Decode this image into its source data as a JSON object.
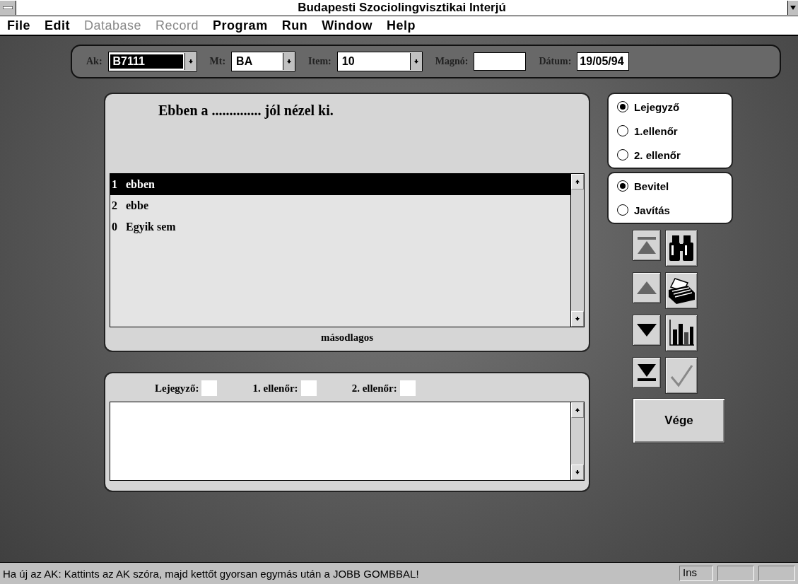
{
  "window": {
    "title": "Budapesti Szociolingvisztikai Interjú"
  },
  "menu": [
    {
      "label": "File",
      "disabled": false
    },
    {
      "label": "Edit",
      "disabled": false
    },
    {
      "label": "Database",
      "disabled": true
    },
    {
      "label": "Record",
      "disabled": true
    },
    {
      "label": "Program",
      "disabled": false
    },
    {
      "label": "Run",
      "disabled": false
    },
    {
      "label": "Window",
      "disabled": false
    },
    {
      "label": "Help",
      "disabled": false
    }
  ],
  "toolbar": [
    {
      "kind": "dropdown",
      "label": "Ak:",
      "value": "B7111",
      "highlighted": true
    },
    {
      "kind": "dropdown",
      "label": "Mt:",
      "value": "BA",
      "highlighted": false
    },
    {
      "kind": "dropdown",
      "label": "Item:",
      "value": "10",
      "highlighted": false
    },
    {
      "kind": "field",
      "label": "Magnó:"
    },
    {
      "kind": "field",
      "label": "Dátum:",
      "value": "19/05/94"
    }
  ],
  "question": "Ebben a .............. jól nézel ki.",
  "answers": [
    {
      "number": "1",
      "text": "ebben",
      "selected": true
    },
    {
      "number": "2",
      "text": "ebbe",
      "selected": false
    },
    {
      "number": "0",
      "text": "Egyik sem",
      "selected": false
    }
  ],
  "answers_caption": "másodlagos",
  "reviewers": [
    "Lejegyző:",
    "1. ellenőr:",
    "2. ellenőr:"
  ],
  "role_group": [
    {
      "label": "Lejegyző",
      "selected": true
    },
    {
      "label": "1.ellenőr",
      "selected": false
    },
    {
      "label": "2. ellenőr",
      "selected": false
    }
  ],
  "mode_group": [
    {
      "label": "Bevitel",
      "selected": true
    },
    {
      "label": "Javítás",
      "selected": false
    }
  ],
  "tools": [
    {
      "kind": "first"
    },
    {
      "kind": "find"
    },
    {
      "kind": "prev"
    },
    {
      "kind": "cardfile"
    },
    {
      "kind": "next"
    },
    {
      "kind": "chart"
    },
    {
      "kind": "last"
    },
    {
      "kind": "check",
      "disabled": true
    }
  ],
  "end_button": "Vége",
  "status_bar": {
    "message": "Ha új az AK: Kattints az AK szóra, majd  kettőt gyorsan egymás után a JOBB GOMBBAL!",
    "panels": [
      "Ins"
    ]
  }
}
